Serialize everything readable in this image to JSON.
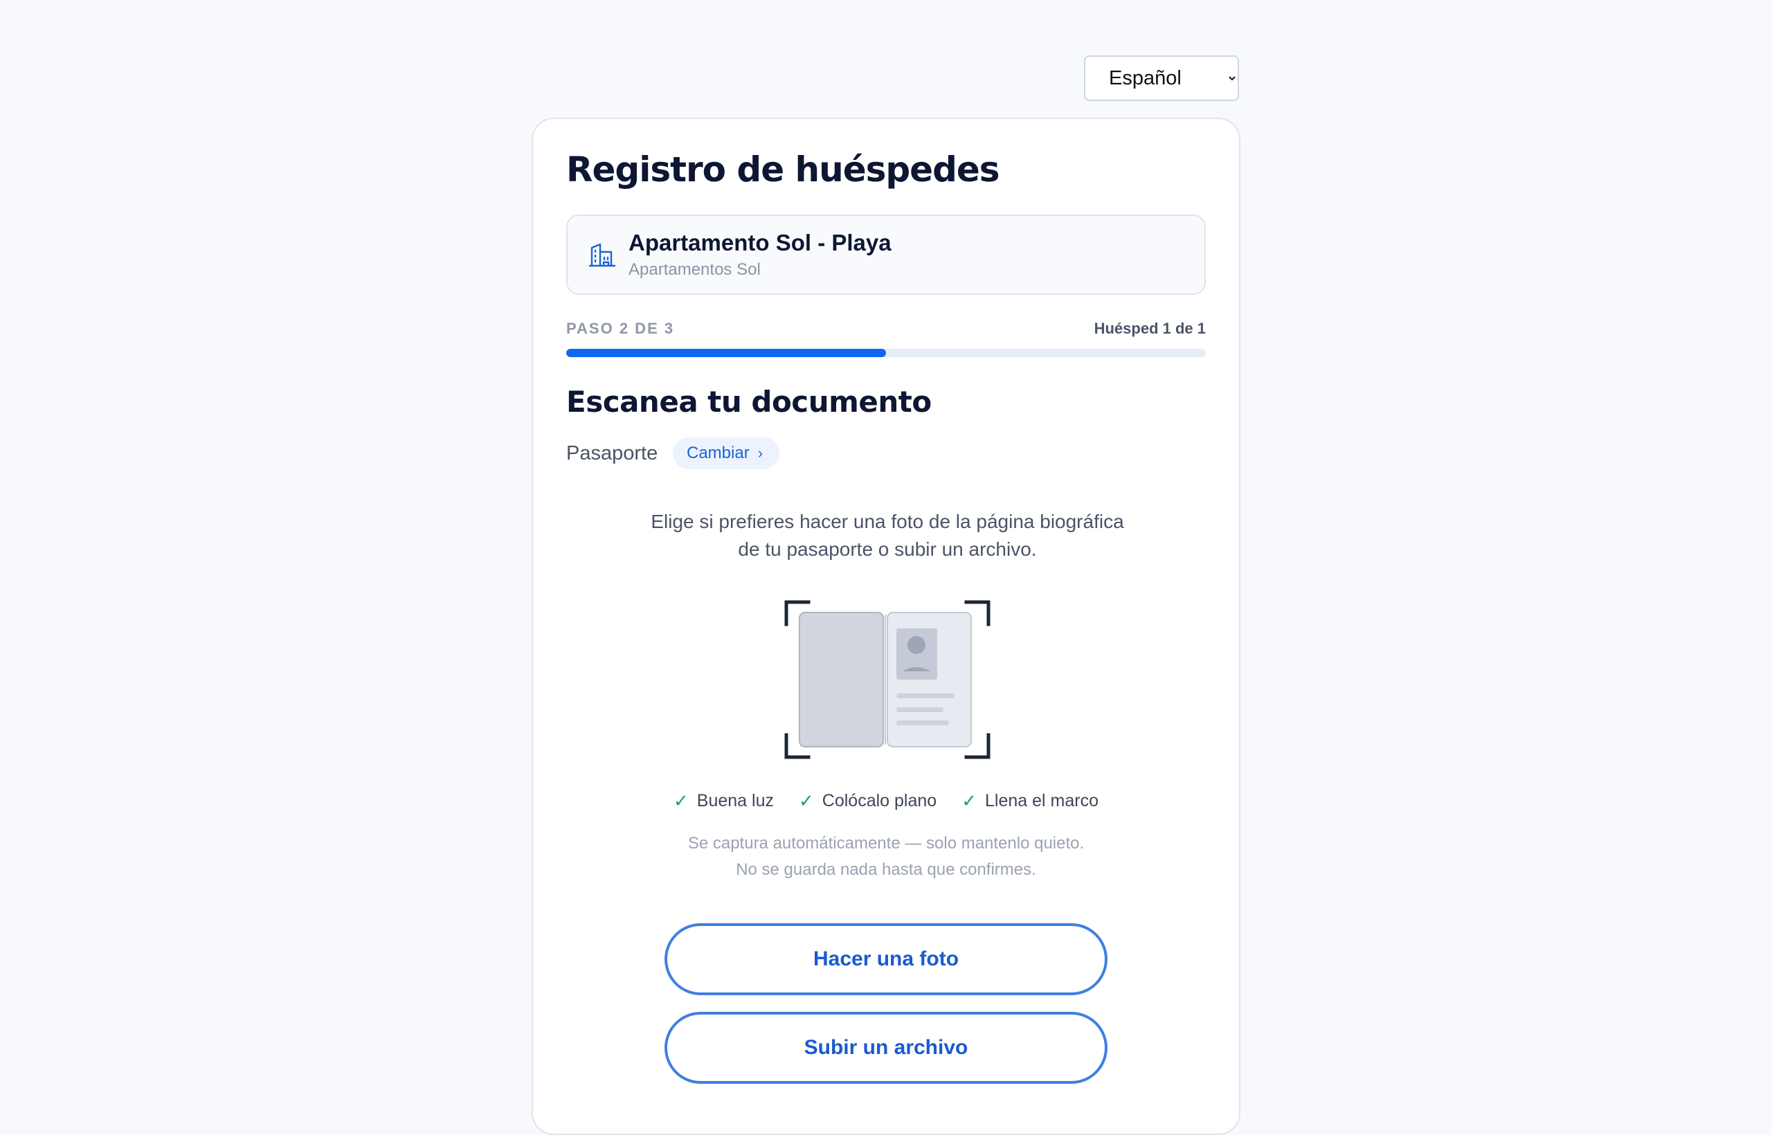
{
  "language": {
    "selected": "Español",
    "options": [
      "Español"
    ]
  },
  "header": {
    "title": "Registro de huéspedes"
  },
  "property": {
    "icon": "building-icon",
    "name": "Apartamento Sol - Playa",
    "brand": "Apartamentos Sol"
  },
  "progress": {
    "step_label": "PASO 2 DE 3",
    "guest_label": "Huésped 1 de 1",
    "fraction": 0.5,
    "color": "#1166ee"
  },
  "document": {
    "section_title": "Escanea tu documento",
    "type": "Pasaporte",
    "change_label": "Cambiar",
    "instruction": "Elige si prefieres hacer una foto de la página biográfica de tu pasaporte o subir un archivo.",
    "illustration_icon": "passport-scan-icon",
    "tips": [
      "Buena luz",
      "Colócalo plano",
      "Llena el marco"
    ],
    "auto_note_1": "Se captura automáticamente — solo mantenlo quieto.",
    "auto_note_2": "No se guarda nada hasta que confirmes."
  },
  "actions": {
    "photo_label": "Hacer una foto",
    "upload_label": "Subir un archivo",
    "accent": "#3f7fe0"
  }
}
